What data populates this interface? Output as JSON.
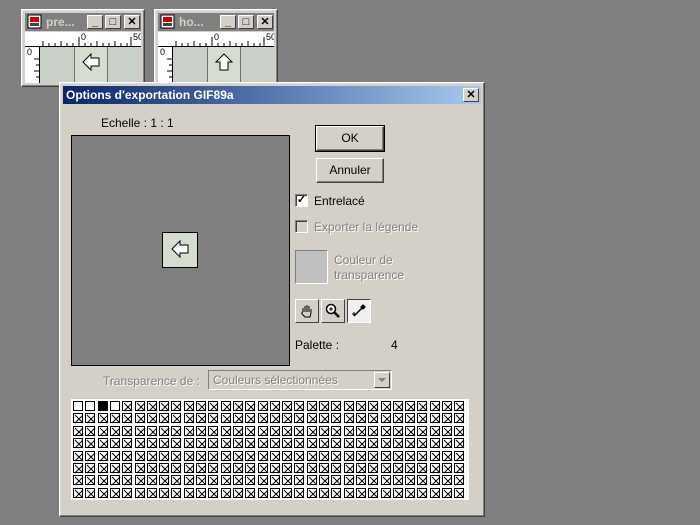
{
  "windows": [
    {
      "title": "pre...",
      "ruler_h": [
        "0",
        "50"
      ],
      "ruler_v": "0",
      "icon": "arrow-left-icon"
    },
    {
      "title": "ho...",
      "ruler_h": [
        "0",
        "50"
      ],
      "ruler_v": "0",
      "icon": "arrow-up-icon"
    }
  ],
  "dialog": {
    "title": "Options d'exportation GIF89a",
    "scale_label": "Echelle : 1 : 1",
    "ok_label": "OK",
    "cancel_label": "Annuler",
    "interlaced_label": "Entrelacé",
    "interlaced_checked": true,
    "export_caption_label": "Exporter la légende",
    "transparency_color_label_1": "Couleur de",
    "transparency_color_label_2": "transparence",
    "tools": [
      "hand-tool-icon",
      "zoom-tool-icon",
      "eyedropper-tool-icon"
    ],
    "palette_label": "Palette :",
    "palette_count": "4",
    "transparency_from_label": "Transparence de :",
    "transparency_from_value": "Couleurs sélectionnées",
    "palette_swatches": {
      "colors": [
        "#ffffff",
        "#ffffff",
        "#000000",
        "#ffffff"
      ],
      "columns": 32,
      "rows": 8
    }
  }
}
